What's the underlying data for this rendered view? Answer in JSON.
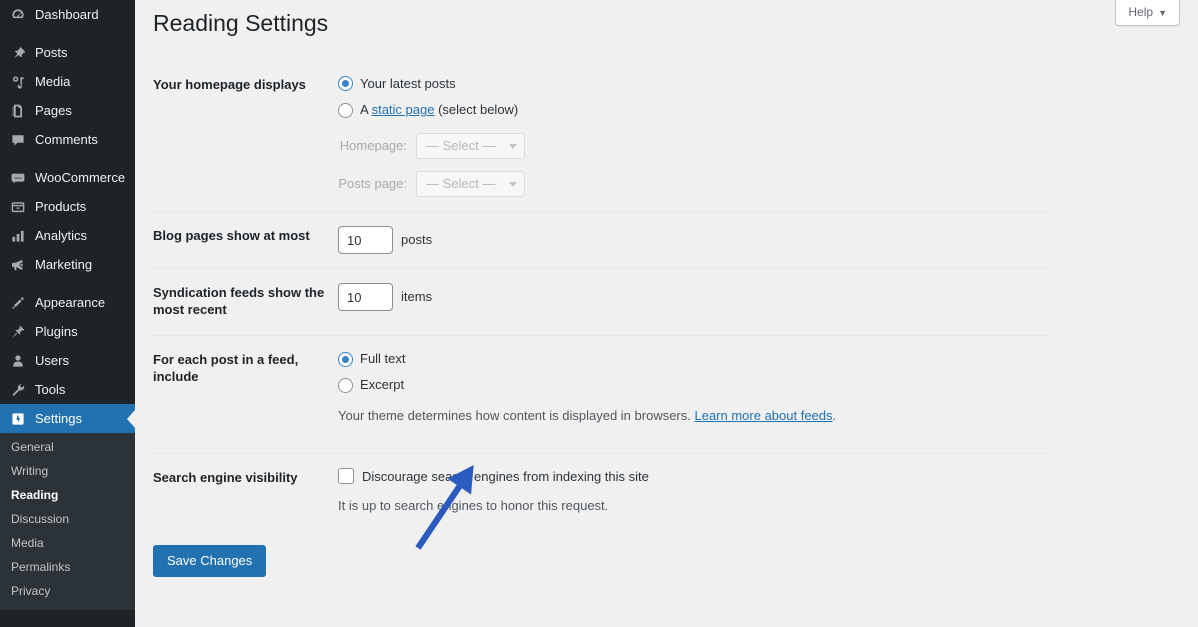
{
  "sidebar": {
    "items": [
      {
        "label": "Dashboard",
        "icon": "dashboard-icon"
      },
      {
        "label": "Posts",
        "icon": "pin-icon"
      },
      {
        "label": "Media",
        "icon": "media-icon"
      },
      {
        "label": "Pages",
        "icon": "pages-icon"
      },
      {
        "label": "Comments",
        "icon": "comments-icon"
      },
      {
        "label": "WooCommerce",
        "icon": "woocommerce-icon"
      },
      {
        "label": "Products",
        "icon": "products-icon"
      },
      {
        "label": "Analytics",
        "icon": "analytics-icon"
      },
      {
        "label": "Marketing",
        "icon": "megaphone-icon"
      },
      {
        "label": "Appearance",
        "icon": "paintbrush-icon"
      },
      {
        "label": "Plugins",
        "icon": "plug-icon"
      },
      {
        "label": "Users",
        "icon": "user-icon"
      },
      {
        "label": "Tools",
        "icon": "wrench-icon"
      },
      {
        "label": "Settings",
        "icon": "settings-icon"
      }
    ],
    "submenu": [
      {
        "label": "General"
      },
      {
        "label": "Writing"
      },
      {
        "label": "Reading"
      },
      {
        "label": "Discussion"
      },
      {
        "label": "Media"
      },
      {
        "label": "Permalinks"
      },
      {
        "label": "Privacy"
      }
    ],
    "current_item": "Settings",
    "current_submenu": "Reading",
    "accent_color": "#2271b1",
    "background_color": "#1d2327",
    "submenu_background_color": "#2c3338"
  },
  "header": {
    "title": "Reading Settings",
    "help_label": "Help",
    "help_caret": "▼"
  },
  "form": {
    "homepage_displays": {
      "label": "Your homepage displays",
      "options": [
        {
          "label": "Your latest posts",
          "selected": true
        },
        {
          "label_prefix": "A ",
          "link": "static page",
          "label_suffix": " (select below)",
          "selected": false
        }
      ],
      "homepage_select": {
        "label": "Homepage:",
        "value": "— Select —",
        "disabled": true
      },
      "posts_page_select": {
        "label": "Posts page:",
        "value": "— Select —",
        "disabled": true
      }
    },
    "blog_pages": {
      "label": "Blog pages show at most",
      "value": "10",
      "unit": "posts"
    },
    "syndication_feeds": {
      "label": "Syndication feeds show the most recent",
      "value": "10",
      "unit": "items"
    },
    "feed_include": {
      "label": "For each post in a feed, include",
      "options": [
        {
          "label": "Full text",
          "selected": true
        },
        {
          "label": "Excerpt",
          "selected": false
        }
      ],
      "description_text": "Your theme determines how content is displayed in browsers. ",
      "description_link": "Learn more about feeds",
      "description_suffix": "."
    },
    "search_engine_visibility": {
      "label": "Search engine visibility",
      "checkbox_label": "Discourage search engines from indexing this site",
      "checked": false,
      "description": "It is up to search engines to honor this request."
    },
    "submit_label": "Save Changes"
  },
  "annotation": {
    "arrow_color": "#2b5bbf",
    "target": "discourage-search-engines-checkbox"
  }
}
